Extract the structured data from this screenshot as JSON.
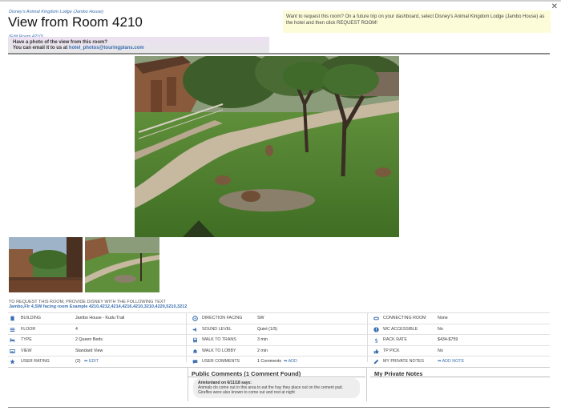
{
  "header": {
    "resort_link": "Disney's Animal Kingdom Lodge (Jambo House)",
    "title": "View from Room 4210",
    "edit_link": "(Edit Room 4210)",
    "close_glyph": "✕"
  },
  "photo_banner": {
    "line1": "Have a photo of the view from this room?",
    "line2_prefix": "You can email it to us at ",
    "email": "hotel_photos@touringplans.com"
  },
  "request_box": {
    "text": "Want to request this room? On a future trip on your dashboard, select Disney's Animal Kingdom Lodge (Jambo House) as the hotel and then click REQUEST ROOM!"
  },
  "request_info": {
    "label": "TO REQUEST THIS ROOM, PROVIDE DISNEY WITH THE FOLLOWING TEXT",
    "rooms": "Jambo,Flr 4,SW facing room Example 4210,4212,4214,4216,4210,3210,4220,5210,3212"
  },
  "details": {
    "col1": [
      {
        "icon": "building-icon",
        "label": "BUILDING",
        "value": "Jambo House - Kudu Trail"
      },
      {
        "icon": "floor-icon",
        "label": "FLOOR",
        "value": "4"
      },
      {
        "icon": "bed-icon",
        "label": "TYPE",
        "value": "2 Queen Beds"
      },
      {
        "icon": "image-icon",
        "label": "VIEW",
        "value": "Standard View"
      },
      {
        "icon": "star-icon",
        "label": "USER RATING",
        "value": "(2)",
        "action": "EDIT"
      }
    ],
    "col2": [
      {
        "icon": "compass-icon",
        "label": "DIRECTION FACING",
        "value": "SW"
      },
      {
        "icon": "speaker-icon",
        "label": "SOUND LEVEL",
        "value": "Quiet (1/5)"
      },
      {
        "icon": "bus-icon",
        "label": "WALK TO TRANS",
        "value": "3 min"
      },
      {
        "icon": "bell-icon",
        "label": "WALK TO LOBBY",
        "value": "2 min"
      },
      {
        "icon": "comments-icon",
        "label": "USER COMMENTS",
        "value": "1 Comments",
        "action": "ADD"
      }
    ],
    "col3": [
      {
        "icon": "link-icon",
        "label": "CONNECTING ROOM",
        "value": "None"
      },
      {
        "icon": "wheelchair-icon",
        "label": "WC ACCESSIBLE",
        "value": "No"
      },
      {
        "icon": "dollar-icon",
        "label": "RACK RATE",
        "value": "$434-$759"
      },
      {
        "icon": "thumbs-up-icon",
        "label": "TP PICK",
        "value": "No"
      },
      {
        "icon": "pencil-icon",
        "label": "MY PRIVATE NOTES",
        "value": "",
        "action": "ADD NOTE"
      }
    ]
  },
  "public_comments": {
    "title": "Public Comments (1 Comment Found)",
    "comment": {
      "author_line": "Arielonland on 6/11/18 says:",
      "line1": "Animals do come out in this area to eat the hay they place out on the cement pad.",
      "line2": "Giraffes were also known to come out and rest at night"
    }
  },
  "private_notes": {
    "title": "My Private Notes"
  },
  "colors": {
    "link": "#3a6fb0",
    "request_box_bg": "#fdfcd9",
    "icon": "#3a6fb0"
  }
}
